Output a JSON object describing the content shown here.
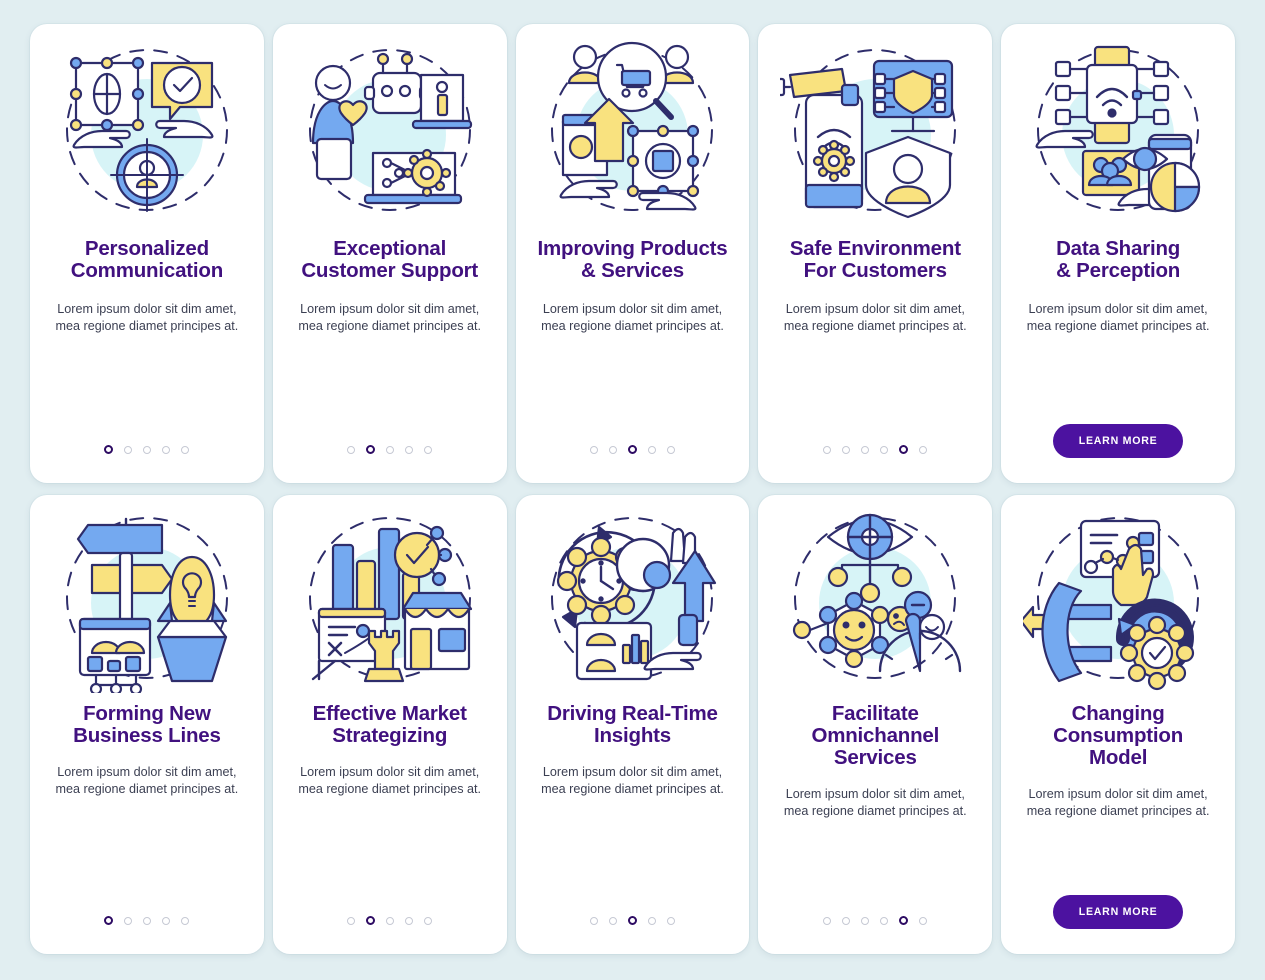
{
  "palette": {
    "page_background": "#e1eef1",
    "card_background": "#ffffff",
    "title_color": "#41117f",
    "body_color": "#3b3f52",
    "button_background": "#4c12a0",
    "button_text": "#ffffff",
    "dot_active": "#2d0b63",
    "dot_inactive": "#c6c9d4",
    "illustration_outline": "#2e2d6b",
    "illustration_blue": "#74a9f0",
    "illustration_yellow": "#f9e27f",
    "illustration_cyan": "#c9f0f4"
  },
  "shared": {
    "description": "Lorem ipsum dolor sit dim amet, mea regione diamet principes at.",
    "learn_more_label": "LEARN MORE"
  },
  "screens": [
    {
      "id": "personalized-communication",
      "icon": "network-hands-target-person-icon",
      "title_lines": [
        "Personalized",
        "Communication"
      ],
      "description": "Lorem ipsum dolor sit dim amet, mea regione diamet principes at.",
      "dots_total": 5,
      "dot_active_index": 0,
      "has_button": false
    },
    {
      "id": "exceptional-customer-support",
      "icon": "chatbot-support-laptop-icon",
      "title_lines": [
        "Exceptional",
        "Customer Support"
      ],
      "description": "Lorem ipsum dolor sit dim amet, mea regione diamet principes at.",
      "dots_total": 5,
      "dot_active_index": 1,
      "has_button": false
    },
    {
      "id": "improving-products-services",
      "icon": "cart-magnifier-product-chip-icon",
      "title_lines": [
        "Improving Products",
        "& Services"
      ],
      "description": "Lorem ipsum dolor sit dim amet, mea regione diamet principes at.",
      "dots_total": 5,
      "dot_active_index": 2,
      "has_button": false
    },
    {
      "id": "safe-environment-for-customers",
      "icon": "camera-phone-shield-monitor-icon",
      "title_lines": [
        "Safe Environment",
        "For Customers"
      ],
      "description": "Lorem ipsum dolor sit dim amet, mea regione diamet principes at.",
      "dots_total": 6,
      "dot_active_index": 4,
      "has_button": false
    },
    {
      "id": "data-sharing-perception",
      "icon": "wifi-hands-eye-chart-icon",
      "title_lines": [
        "Data Sharing",
        "& Perception"
      ],
      "description": "Lorem ipsum dolor sit dim amet, mea regione diamet principes at.",
      "dots_total": 0,
      "dot_active_index": -1,
      "has_button": true,
      "button_label": "LEARN MORE"
    },
    {
      "id": "forming-new-business-lines",
      "icon": "signpost-rocket-box-icon",
      "title_lines": [
        "Forming New",
        "Business Lines"
      ],
      "description": "Lorem ipsum dolor sit dim amet, mea regione diamet principes at.",
      "dots_total": 5,
      "dot_active_index": 0,
      "has_button": false
    },
    {
      "id": "effective-market-strategizing",
      "icon": "barchart-chess-rook-store-icon",
      "title_lines": [
        "Effective Market",
        "Strategizing"
      ],
      "description": "Lorem ipsum dolor sit dim amet, mea regione diamet principes at.",
      "dots_total": 5,
      "dot_active_index": 1,
      "has_button": false
    },
    {
      "id": "driving-real-time-insights",
      "icon": "clock-gear-arrow-dashboard-icon",
      "title_lines": [
        "Driving Real-Time",
        "Insights"
      ],
      "description": "Lorem ipsum dolor sit dim amet, mea regione diamet principes at.",
      "dots_total": 5,
      "dot_active_index": 2,
      "has_button": false
    },
    {
      "id": "facilitate-omnichannel-services",
      "icon": "eye-network-smiley-gauge-icon",
      "title_lines": [
        "Facilitate",
        "Omnichannel",
        "Services"
      ],
      "description": "Lorem ipsum dolor sit dim amet, mea regione diamet principes at.",
      "dots_total": 6,
      "dot_active_index": 4,
      "has_button": false
    },
    {
      "id": "changing-consumption-model",
      "icon": "dashboard-hand-arrows-gear-icon",
      "title_lines": [
        "Changing",
        "Consumption",
        "Model"
      ],
      "description": "Lorem ipsum dolor sit dim amet, mea regione diamet principes at.",
      "dots_total": 0,
      "dot_active_index": -1,
      "has_button": true,
      "button_label": "LEARN MORE"
    }
  ]
}
